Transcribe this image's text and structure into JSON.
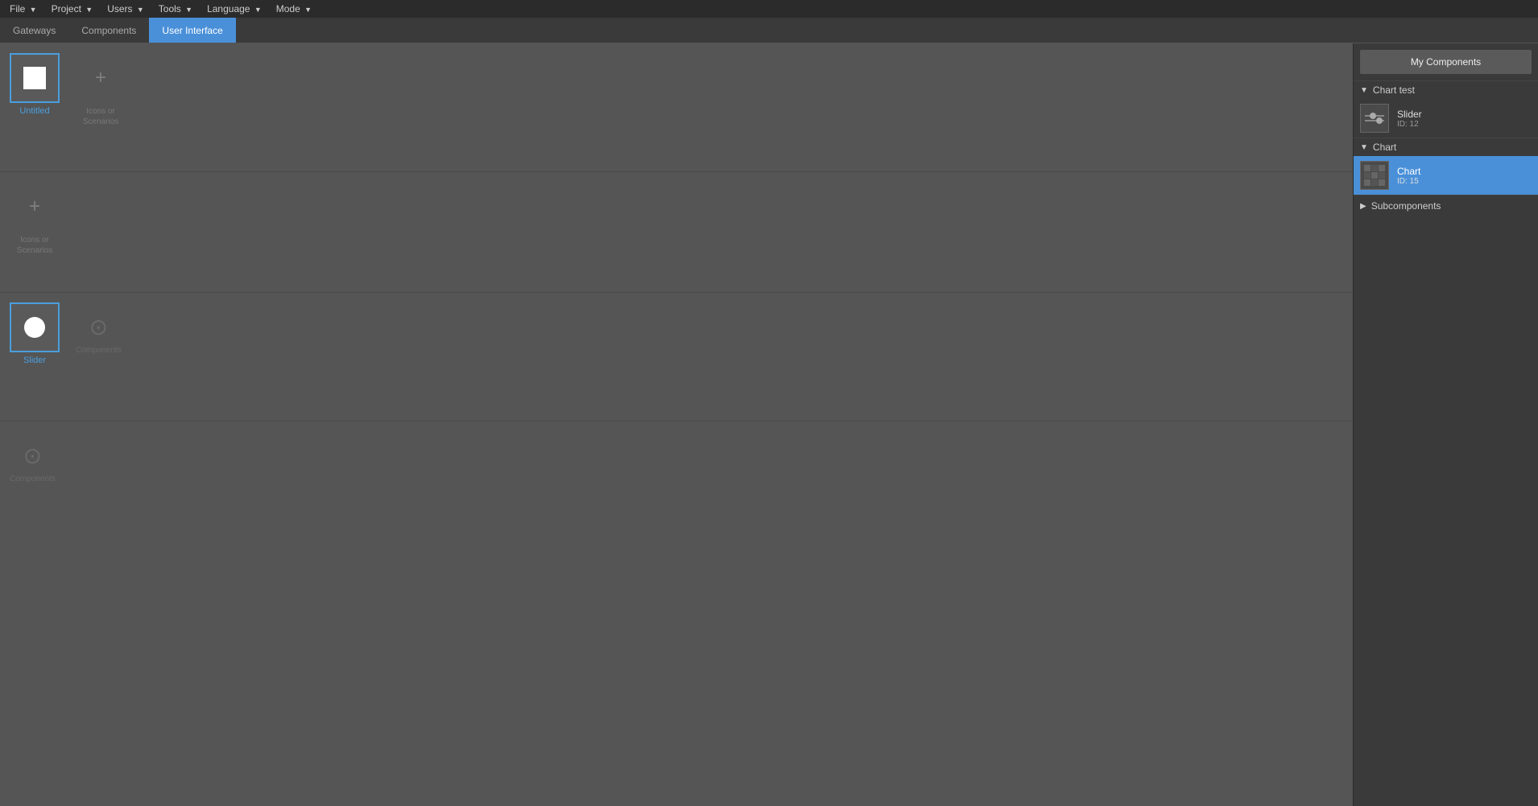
{
  "menubar": {
    "items": [
      {
        "label": "File",
        "id": "file"
      },
      {
        "label": "Project",
        "id": "project"
      },
      {
        "label": "Users",
        "id": "users"
      },
      {
        "label": "Tools",
        "id": "tools"
      },
      {
        "label": "Language",
        "id": "language"
      },
      {
        "label": "Mode",
        "id": "mode"
      }
    ]
  },
  "tabbar": {
    "tabs": [
      {
        "label": "Gateways",
        "id": "gateways",
        "active": false
      },
      {
        "label": "Components",
        "id": "components",
        "active": false
      },
      {
        "label": "User Interface",
        "id": "user-interface",
        "active": true
      }
    ]
  },
  "canvas": {
    "rows": [
      {
        "id": "row1",
        "items": [
          {
            "type": "component",
            "label": "Untitled",
            "icon": "square"
          },
          {
            "type": "add",
            "label": "Icons or\nScenarios"
          }
        ]
      },
      {
        "id": "row2",
        "items": [
          {
            "type": "add",
            "label": "Icons or\nScenarios"
          }
        ]
      },
      {
        "id": "row3",
        "items": [
          {
            "type": "component",
            "label": "Slider",
            "icon": "circle"
          },
          {
            "type": "down",
            "label": "Components"
          }
        ]
      },
      {
        "id": "row4",
        "items": [
          {
            "type": "down",
            "label": "Components"
          }
        ]
      }
    ]
  },
  "right_panel": {
    "my_components_label": "My Components",
    "sections": [
      {
        "id": "chart-test",
        "label": "Chart test",
        "collapsed": false,
        "items": [
          {
            "name": "Slider",
            "id": "ID: 12",
            "icon": "slider",
            "selected": false
          }
        ]
      },
      {
        "id": "chart",
        "label": "Chart",
        "collapsed": false,
        "items": [
          {
            "name": "Chart",
            "id": "ID: 15",
            "icon": "chart",
            "selected": true
          }
        ]
      },
      {
        "id": "subcomponents",
        "label": "Subcomponents",
        "collapsed": true,
        "items": []
      }
    ]
  }
}
